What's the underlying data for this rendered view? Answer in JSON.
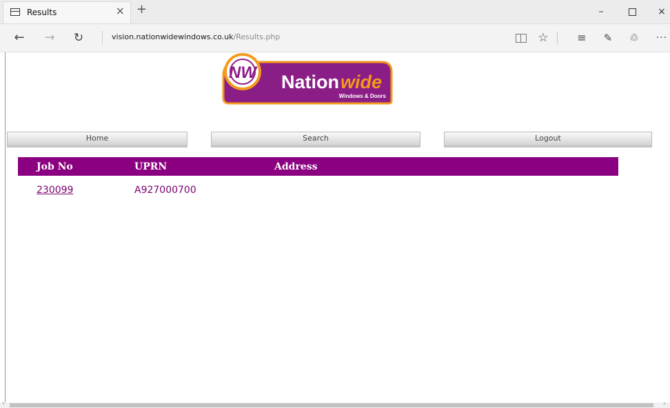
{
  "browser": {
    "tab_title": "Results",
    "tab_close": "×",
    "new_tab": "+",
    "url_host": "vision.nationwidewindows.co.uk",
    "url_path": "/Results.php",
    "icons": {
      "back": "←",
      "forward": "→",
      "refresh": "↻",
      "star": "☆",
      "hub": "≡",
      "note": "✎",
      "share": "♲",
      "more": "···",
      "minimize": "–",
      "close": "×"
    }
  },
  "logo": {
    "monogram": "NW",
    "brand_main": "Nation",
    "brand_accent": "wide",
    "tagline": "Windows & Doors",
    "colors": {
      "purple": "#8b1e86",
      "orange": "#f39a1d"
    }
  },
  "nav": {
    "home": "Home",
    "search": "Search",
    "logout": "Logout"
  },
  "results": {
    "columns": [
      "Job No",
      "UPRN",
      "Address"
    ],
    "rows": [
      {
        "job_no": "230099",
        "uprn": "A927000700",
        "address": ""
      }
    ],
    "header_color": "#8b0080"
  }
}
